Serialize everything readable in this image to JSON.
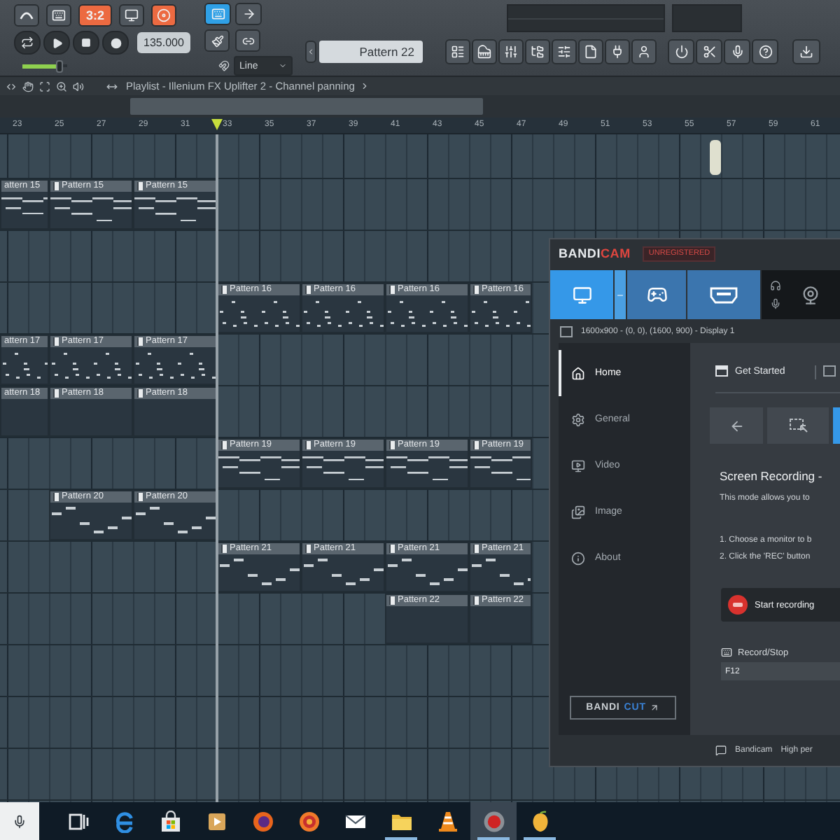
{
  "toolbar": {
    "toggles": [
      {
        "on": false
      },
      {
        "on": false
      },
      {
        "label": "3:2",
        "on": true
      },
      {
        "on": false
      },
      {
        "on": true
      }
    ],
    "tempo": "135.000",
    "master_volume": {
      "level": 0.8
    },
    "tools": [
      {
        "selected": true
      },
      {
        "selected": false
      }
    ],
    "snap": "Line",
    "pattern": "Pattern 22"
  },
  "playlist": {
    "title": "Playlist - Illenium FX Uplifter 2 - Channel panning",
    "ruler": [
      "23",
      "25",
      "27",
      "29",
      "31",
      "33",
      "35",
      "37",
      "39",
      "41",
      "43",
      "45",
      "47",
      "49",
      "51",
      "53",
      "55",
      "57",
      "59",
      "61"
    ],
    "tracks": [
      {
        "kind": "chords",
        "clips": [
          {
            "label": "attern 15"
          },
          {
            "label": "Pattern 15"
          },
          {
            "label": "Pattern 15"
          }
        ]
      },
      {
        "kind": "beats",
        "clips": [
          {
            "label": "Pattern 16"
          },
          {
            "label": "Pattern 16"
          },
          {
            "label": "Pattern 16"
          },
          {
            "label": "Pattern 16"
          }
        ]
      },
      {
        "kind": "beats",
        "clips": [
          {
            "label": "attern 17"
          },
          {
            "label": "Pattern 17"
          },
          {
            "label": "Pattern 17"
          }
        ]
      },
      {
        "kind": "blank",
        "clips": [
          {
            "label": "attern 18"
          },
          {
            "label": "Pattern 18"
          },
          {
            "label": "Pattern 18"
          }
        ]
      },
      {
        "kind": "chords",
        "clips": [
          {
            "label": "Pattern 19"
          },
          {
            "label": "Pattern 19"
          },
          {
            "label": "Pattern 19"
          },
          {
            "label": "Pattern 19"
          }
        ]
      },
      {
        "kind": "melody",
        "clips": [
          {
            "label": "Pattern 20"
          },
          {
            "label": "Pattern 20"
          }
        ]
      },
      {
        "kind": "melody",
        "clips": [
          {
            "label": "Pattern 21"
          },
          {
            "label": "Pattern 21"
          },
          {
            "label": "Pattern 21"
          },
          {
            "label": "Pattern 21"
          }
        ]
      },
      {
        "kind": "blank",
        "clips": [
          {
            "label": "Pattern 22"
          },
          {
            "label": "Pattern 22"
          }
        ]
      }
    ]
  },
  "recorder": {
    "logo": {
      "left": "BANDI",
      "right": "CAM"
    },
    "badge": "UNREGISTERED",
    "modes": [
      {
        "kind": "screen",
        "selected": true
      },
      {
        "kind": "game",
        "selected": false
      },
      {
        "kind": "device",
        "selected": false
      }
    ],
    "area": "1600x900 - (0, 0), (1600, 900) - Display 1",
    "menu": [
      {
        "label": "Home",
        "selected": true
      },
      {
        "label": "General",
        "selected": false
      },
      {
        "label": "Video",
        "selected": false
      },
      {
        "label": "Image",
        "selected": false
      },
      {
        "label": "About",
        "selected": false
      }
    ],
    "bandicut": {
      "left": "BANDI",
      "right": "CUT"
    },
    "tab": "Get Started",
    "nav_buttons": [
      {
        "selected": false
      },
      {
        "selected": false
      },
      {
        "selected": true
      }
    ],
    "heading": "Screen Recording -",
    "intro": "This mode allows you to",
    "steps": [
      "1. Choose a monitor to b",
      "2. Click the 'REC' button"
    ],
    "start_button": "Start recording",
    "hotkey_label": "Record/Stop",
    "hotkey": "F12",
    "status": [
      "Bandicam",
      "High per"
    ]
  },
  "taskbar": {
    "items": [
      {
        "kind": "task_view",
        "open": false,
        "selected": false
      },
      {
        "kind": "browser_e",
        "open": false,
        "selected": false
      },
      {
        "kind": "store",
        "open": false,
        "selected": false
      },
      {
        "kind": "player",
        "open": false,
        "selected": false
      },
      {
        "kind": "fox",
        "open": false,
        "selected": false
      },
      {
        "kind": "fox_alt",
        "open": false,
        "selected": false
      },
      {
        "kind": "mail",
        "open": false,
        "selected": false
      },
      {
        "kind": "folder",
        "open": true,
        "selected": false
      },
      {
        "kind": "cone",
        "open": false,
        "selected": false
      },
      {
        "kind": "recorder",
        "open": true,
        "selected": true
      },
      {
        "kind": "daw",
        "open": true,
        "selected": false
      }
    ]
  }
}
